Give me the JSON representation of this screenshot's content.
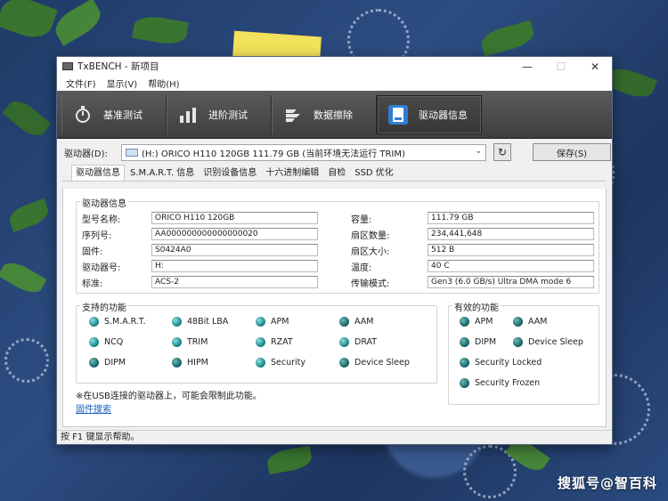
{
  "window": {
    "title": "TxBENCH - 新项目"
  },
  "menu": [
    "文件(F)",
    "显示(V)",
    "帮助(H)"
  ],
  "toolbar": [
    {
      "label": "基准测试",
      "icon": "stopwatch-icon"
    },
    {
      "label": "进阶测试",
      "icon": "bar-chart-icon"
    },
    {
      "label": "数据擦除",
      "icon": "erase-icon"
    },
    {
      "label": "驱动器信息",
      "icon": "drive-info-icon",
      "active": true
    }
  ],
  "drive": {
    "label": "驱动器(D):",
    "selected": "(H:) ORICO H110 120GB  111.79 GB (当前环境无法运行 TRIM)",
    "save_label": "保存(S)"
  },
  "tabs": [
    "驱动器信息",
    "S.M.A.R.T. 信息",
    "识别设备信息",
    "十六进制编辑",
    "自检",
    "SSD 优化"
  ],
  "info": {
    "title": "驱动器信息",
    "left": [
      {
        "label": "型号名称:",
        "value": "ORICO H110 120GB"
      },
      {
        "label": "序列号:",
        "value": "AA000000000000000020"
      },
      {
        "label": "固件:",
        "value": "S0424A0"
      },
      {
        "label": "驱动器号:",
        "value": "H:"
      },
      {
        "label": "标准:",
        "value": "ACS-2"
      }
    ],
    "right": [
      {
        "label": "容量:",
        "value": "111.79 GB"
      },
      {
        "label": "扇区数量:",
        "value": "234,441,648"
      },
      {
        "label": "扇区大小:",
        "value": "512 B"
      },
      {
        "label": "温度:",
        "value": "40 C"
      },
      {
        "label": "传输模式:",
        "value": "Gen3 (6.0 GB/s)  Ultra DMA mode 6"
      }
    ]
  },
  "supported": {
    "title": "支持的功能",
    "items": [
      "S.M.A.R.T.",
      "48Bit LBA",
      "APM",
      "AAM",
      "NCQ",
      "TRIM",
      "RZAT",
      "DRAT",
      "DIPM",
      "HIPM",
      "Security",
      "Device Sleep"
    ]
  },
  "enabled": {
    "title": "有效的功能",
    "items": [
      "APM",
      "AAM",
      "DIPM",
      "Device Sleep",
      "Security Locked",
      "Security Frozen"
    ]
  },
  "note": "※在USB连接的驱动器上，可能会限制此功能。",
  "link": "固件搜索",
  "status": "按 F1 键显示帮助。",
  "watermark": "搜狐号@智百科"
}
